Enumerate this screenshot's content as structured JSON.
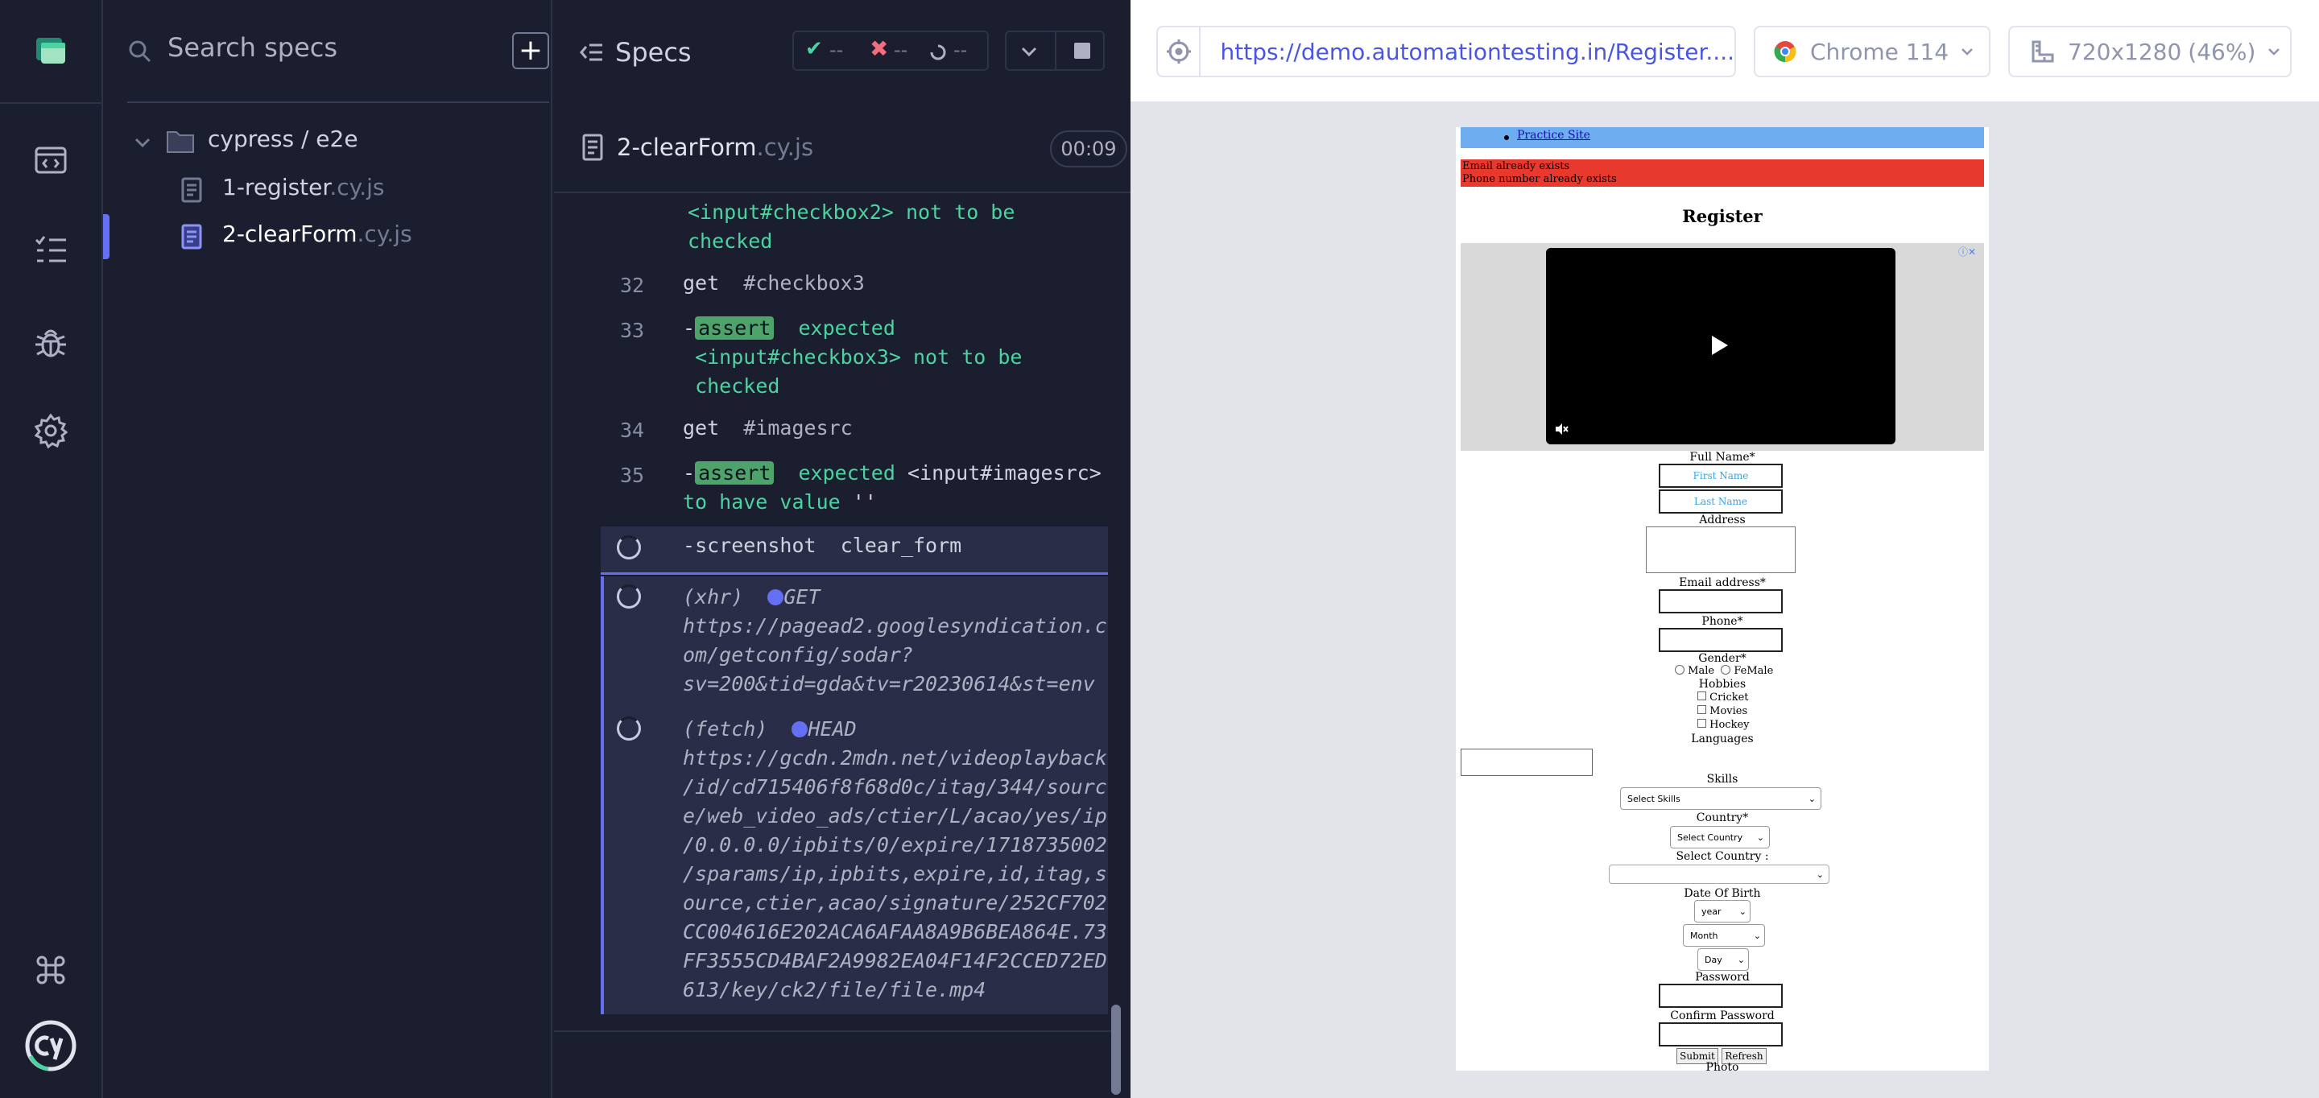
{
  "specs_panel": {
    "search_placeholder": "Search specs",
    "folder": "cypress / e2e",
    "files": [
      {
        "name": "1-register",
        "ext": ".cy.js"
      },
      {
        "name": "2-clearForm",
        "ext": ".cy.js"
      }
    ]
  },
  "log_header": {
    "title": "Specs",
    "passed": "--",
    "failed": "--",
    "pending": "--",
    "spec_name": "2-clearForm",
    "spec_ext": ".cy.js",
    "duration": "00:09"
  },
  "commands": {
    "c0": {
      "line1": "<input#checkbox2>",
      "line1b": "not to be",
      "line2": "checked"
    },
    "c32": {
      "num": "32",
      "name": "get",
      "arg": "#checkbox3"
    },
    "c33": {
      "num": "33",
      "badge": "assert",
      "w1": "expected",
      "line2a": "<input#checkbox3>",
      "line2b": "not to be",
      "line3": "checked"
    },
    "c34": {
      "num": "34",
      "name": "get",
      "arg": "#imagesrc"
    },
    "c35": {
      "num": "35",
      "badge": "assert",
      "w1": "expected",
      "el": "<input#imagesrc>",
      "line2": "to have value",
      "val": "''"
    },
    "shot": {
      "name": "screenshot",
      "arg": "clear_form"
    },
    "xhr": {
      "type": "(xhr)",
      "method": "GET",
      "url": [
        "https://pagead2.googlesyndication.c",
        "om/getconfig/sodar?",
        "sv=200&tid=gda&tv=r20230614&st=env"
      ]
    },
    "fetch": {
      "type": "(fetch)",
      "method": "HEAD",
      "url": [
        "https://gcdn.2mdn.net/videoplayback",
        "/id/cd715406f8f68d0c/itag/344/sourc",
        "e/web_video_ads/ctier/L/acao/yes/ip",
        "/0.0.0.0/ipbits/0/expire/1718735002",
        "/sparams/ip,ipbits,expire,id,itag,s",
        "ource,ctier,acao/signature/252CF702",
        "CC004616E202ACA6AFAA8A9B6BEA864E.73",
        "FF3555CD4BAF2A9982EA04F14F2CCED72ED",
        "613/key/ck2/file/file.mp4"
      ]
    }
  },
  "aut": {
    "url": "https://demo.automationtesting.in/Register....",
    "browser": "Chrome 114",
    "viewport": "720x1280",
    "scale": "(46%)"
  },
  "page": {
    "nav_link": "Practice Site",
    "alert1": "Email already exists",
    "alert2": "Phone number already exists",
    "heading": "Register",
    "full_name": "Full Name*",
    "first_ph": "First Name",
    "last_ph": "Last Name",
    "address": "Address",
    "email": "Email address*",
    "phone": "Phone*",
    "gender": "Gender*",
    "male": "Male",
    "female": "FeMale",
    "hobbies": "Hobbies",
    "hob1": "Cricket",
    "hob2": "Movies",
    "hob3": "Hockey",
    "languages": "Languages",
    "skills": "Skills",
    "skills_sel": "Select Skills",
    "country": "Country*",
    "country_sel": "Select Country",
    "select_country": "Select Country :",
    "dob": "Date Of Birth",
    "year": "year",
    "month": "Month",
    "day": "Day",
    "password": "Password",
    "confirm": "Confirm Password",
    "submit": "Submit",
    "refresh": "Refresh",
    "photo": "Photo"
  },
  "colors": {
    "accent": "#6470f3",
    "pass": "#4bd3a0",
    "fail": "#f26e7e",
    "alert_bg": "#e8392e",
    "nav_bg": "#6eaef0"
  }
}
